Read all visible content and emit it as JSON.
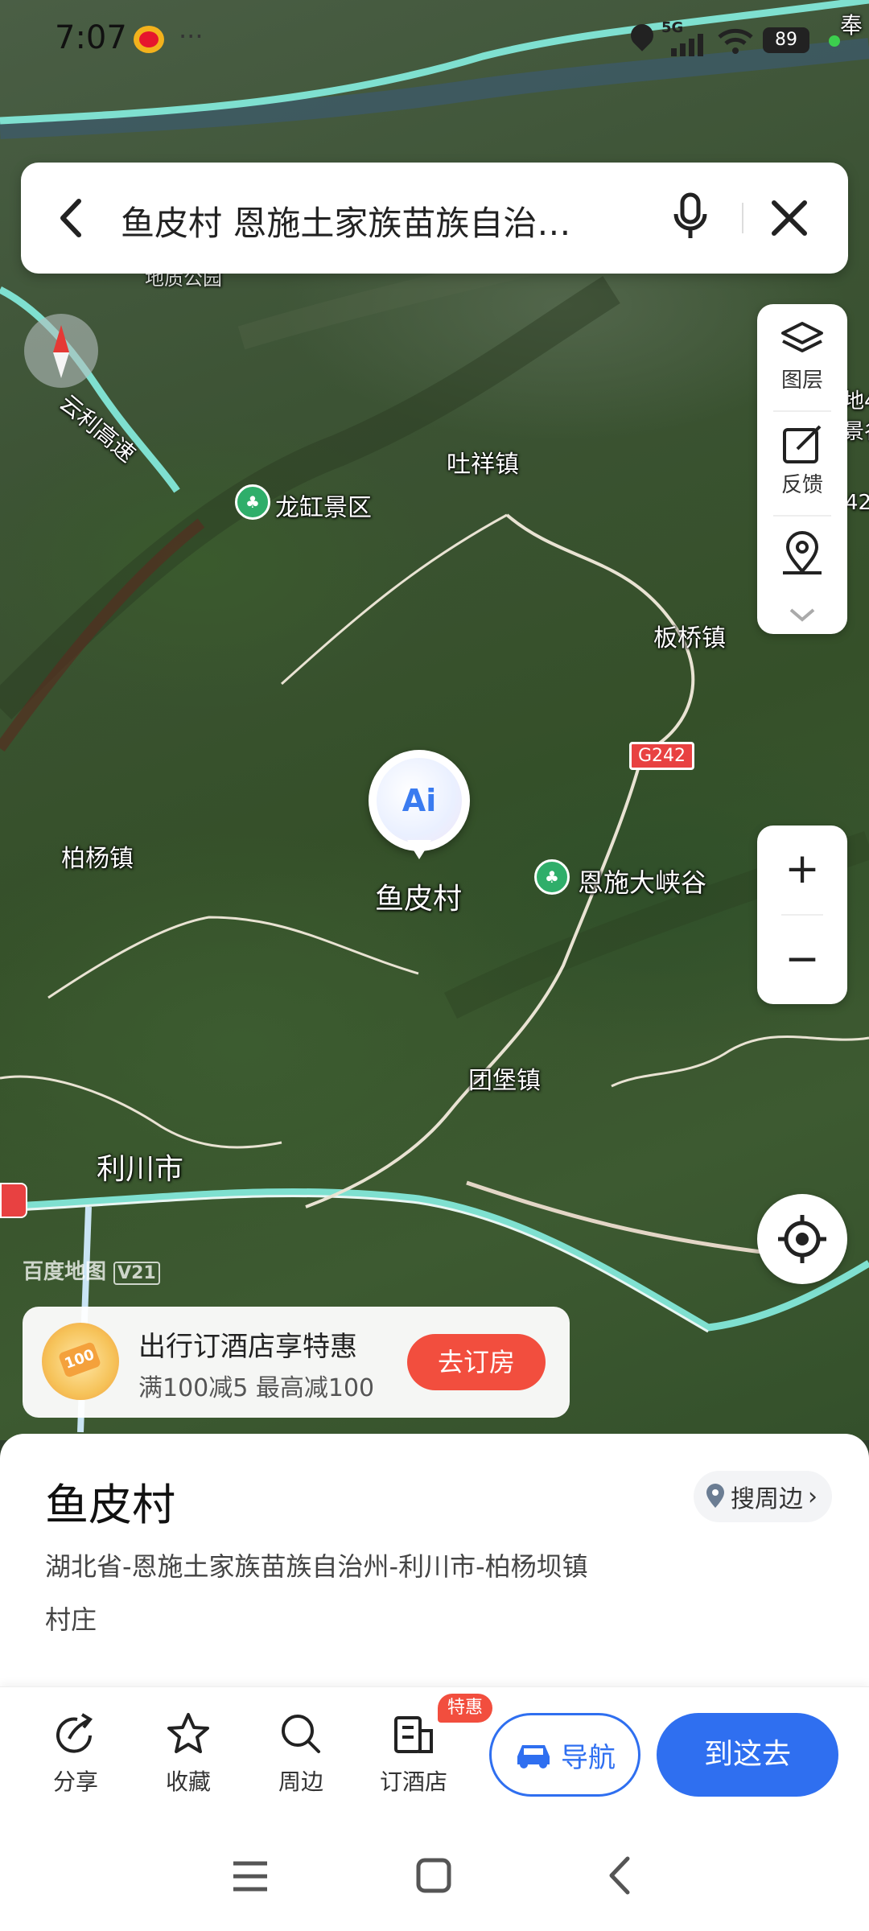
{
  "status_bar": {
    "time": "7:07",
    "dots": "···",
    "network": "5G",
    "battery": "89"
  },
  "search": {
    "query": "鱼皮村 恩施土家族苗族自治…"
  },
  "map": {
    "labels": {
      "yunli_highway": "云利高速",
      "tuxiang_town": "吐祥镇",
      "longgang_scenic": "龙缸景区",
      "banqiao_town": "板桥镇",
      "g242": "G242",
      "baiyang_town": "柏杨镇",
      "enshi_canyon": "恩施大峡谷",
      "yupi_village": "鱼皮村",
      "tuanbao_town": "团堡镇",
      "lichuan_city": "利川市",
      "top_right_partial": "奉",
      "right_partial_1": "地4",
      "right_partial_2": "景谷",
      "right_partial_3": "42",
      "geopark_partial": "地质公园",
      "watermark": "百度地图",
      "watermark_version": "V21",
      "ai_badge": "Ai"
    }
  },
  "tools": {
    "layers_label": "图层",
    "feedback_label": "反馈",
    "zoom_in": "+",
    "zoom_out": "−"
  },
  "promo": {
    "title": "出行订酒店享特惠",
    "subtitle": "满100减5 最高减100",
    "button": "去订房",
    "badge": "100"
  },
  "place": {
    "name": "鱼皮村",
    "nearby_button": "搜周边",
    "address": "湖北省-恩施土家族苗族自治州-利川市-柏杨坝镇",
    "category": "村庄"
  },
  "actions": {
    "share": "分享",
    "favorite": "收藏",
    "nearby": "周边",
    "hotel": "订酒店",
    "hotel_badge": "特惠",
    "navigate": "导航",
    "go_here": "到这去"
  },
  "colors": {
    "accent_blue": "#2f6ff0",
    "promo_red": "#f24e3e",
    "road_cyan": "#7fe0d0",
    "poi_green": "#2fae6a"
  }
}
